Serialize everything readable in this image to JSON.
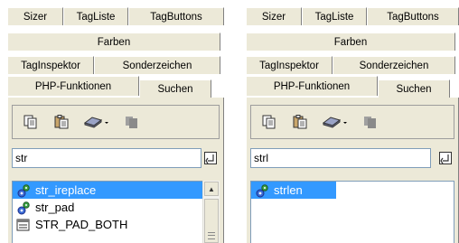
{
  "tabs": {
    "sizer": "Sizer",
    "tagliste": "TagListe",
    "tagbuttons": "TagButtons",
    "farben": "Farben",
    "taginspektor": "TagInspektor",
    "sonderzeichen": "Sonderzeichen",
    "php_funktionen": "PHP-Funktionen",
    "suchen": "Suchen"
  },
  "toolbar": {
    "icons": [
      "copy-icon",
      "paste-icon",
      "book-dropdown-icon",
      "disabled-icon"
    ]
  },
  "left": {
    "filter_value": "str",
    "items": [
      {
        "label": "str_ireplace",
        "icon": "php-function-icon",
        "selected": true
      },
      {
        "label": "str_pad",
        "icon": "php-function-icon",
        "selected": false
      },
      {
        "label": "STR_PAD_BOTH",
        "icon": "php-constant-icon",
        "selected": false
      }
    ]
  },
  "right": {
    "filter_value": "strl",
    "items": [
      {
        "label": "strlen",
        "icon": "php-function-icon",
        "selected": true
      }
    ]
  },
  "colors": {
    "selection": "#3399ff",
    "tab_bg": "#ece9d8",
    "input_border": "#7f9db9"
  }
}
